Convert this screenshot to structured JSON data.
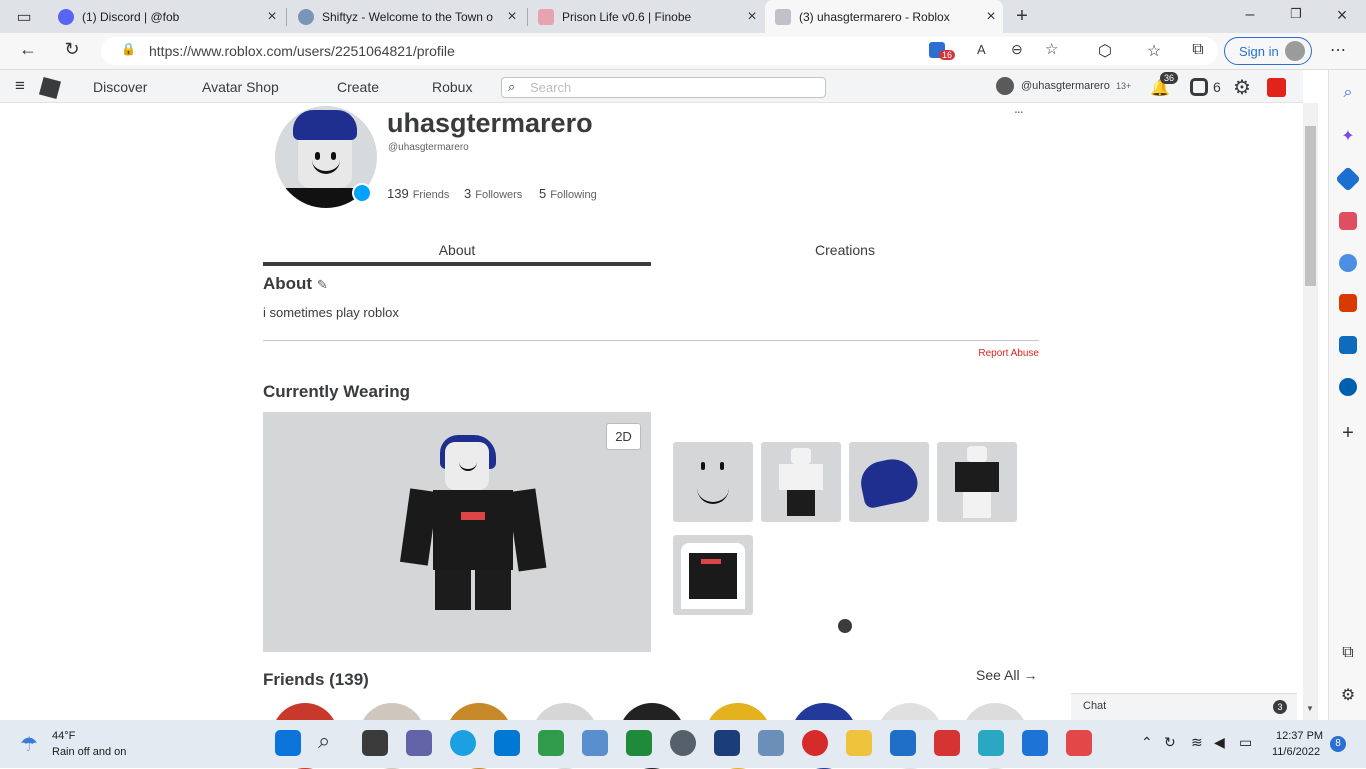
{
  "browser": {
    "tabs": [
      {
        "title": "(1) Discord | @fob",
        "active": false
      },
      {
        "title": "Shiftyz - Welcome to the Town o",
        "active": false
      },
      {
        "title": "Prison Life v0.6 | Finobe",
        "active": false
      },
      {
        "title": "(3) uhasgtermarero - Roblox",
        "active": true
      }
    ],
    "url": "https://www.roblox.com/users/2251064821/profile",
    "extension_badge": "16",
    "sign_in_label": "Sign in"
  },
  "header": {
    "nav": [
      "Discover",
      "Avatar Shop",
      "Create",
      "Robux"
    ],
    "search_placeholder": "Search",
    "account": "@uhasgtermarero",
    "age_label": "13+",
    "notifications_count": "36",
    "robux_count": "6"
  },
  "profile": {
    "username": "uhasgtermarero",
    "handle": "@uhasgtermarero",
    "more": "...",
    "stats": {
      "friends_count": "139",
      "friends_label": "Friends",
      "followers_count": "3",
      "followers_label": "Followers",
      "following_count": "5",
      "following_label": "Following"
    },
    "tabs": [
      "About",
      "Creations"
    ],
    "about_heading": "About",
    "about_text": "i sometimes play roblox",
    "report_label": "Report Abuse",
    "wearing_heading": "Currently Wearing",
    "toggle_2d_label": "2D",
    "friends_heading": "Friends (139)",
    "see_all_label": "See All →"
  },
  "chat": {
    "label": "Chat",
    "count": "3"
  },
  "taskbar": {
    "weather_temp": "44°F",
    "weather_desc": "Rain off and on",
    "time": "12:37 PM",
    "date": "11/6/2022",
    "notification_count": "8"
  }
}
